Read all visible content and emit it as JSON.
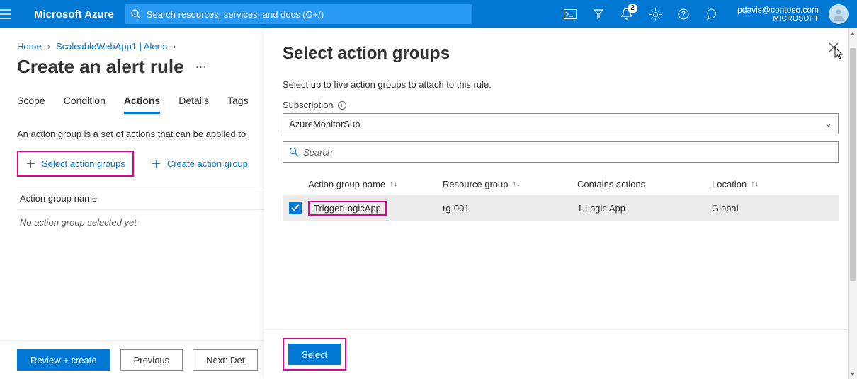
{
  "topbar": {
    "brand": "Microsoft Azure",
    "search_placeholder": "Search resources, services, and docs (G+/)",
    "notification_badge": "2",
    "account_email": "pdavis@contoso.com",
    "account_tenant": "MICROSOFT"
  },
  "breadcrumb": {
    "items": [
      "Home",
      "ScaleableWebApp1 | Alerts"
    ]
  },
  "page": {
    "title": "Create an alert rule",
    "tabs": [
      "Scope",
      "Condition",
      "Actions",
      "Details",
      "Tags"
    ],
    "active_tab": "Actions",
    "description": "An action group is a set of actions that can be applied to",
    "select_action_groups_label": "Select action groups",
    "create_action_group_label": "Create action group",
    "ag_header": "Action group name",
    "ag_empty": "No action group selected yet",
    "btn_review": "Review + create",
    "btn_prev": "Previous",
    "btn_next": "Next: Det"
  },
  "panel": {
    "title": "Select action groups",
    "help": "Select up to five action groups to attach to this rule.",
    "subscription_label": "Subscription",
    "subscription_value": "AzureMonitorSub",
    "search_placeholder": "Search",
    "columns": {
      "name": "Action group name",
      "rg": "Resource group",
      "actions": "Contains actions",
      "location": "Location"
    },
    "rows": [
      {
        "name": "TriggerLogicApp",
        "rg": "rg-001",
        "actions": "1 Logic App",
        "location": "Global",
        "checked": true
      }
    ],
    "select_btn": "Select"
  }
}
